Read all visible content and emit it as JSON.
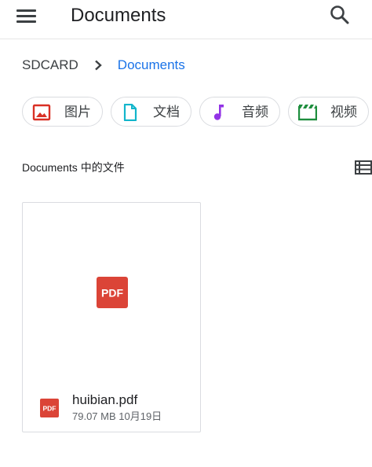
{
  "appbar": {
    "title": "Documents",
    "menu_icon": "hamburger-menu-icon",
    "search_icon": "search-icon"
  },
  "breadcrumb": {
    "root": "SDCARD",
    "separator_icon": "chevron-right-icon",
    "current": "Documents"
  },
  "chips": [
    {
      "label": "图片",
      "icon": "image-icon",
      "color": "#d93025"
    },
    {
      "label": "文档",
      "icon": "document-icon",
      "color": "#12b5cb"
    },
    {
      "label": "音频",
      "icon": "music-note-icon",
      "color": "#9334e6"
    },
    {
      "label": "视频",
      "icon": "video-clapper-icon",
      "color": "#1e8e3e"
    }
  ],
  "section": {
    "title": "Documents 中的文件",
    "view_toggle_icon": "list-view-icon"
  },
  "files": [
    {
      "name": "huibian.pdf",
      "size": "79.07 MB",
      "date": "10月19日",
      "meta": "79.07 MB 10月19日",
      "icon": "pdf-icon",
      "icon_label": "PDF",
      "icon_color": "#db4437"
    }
  ]
}
